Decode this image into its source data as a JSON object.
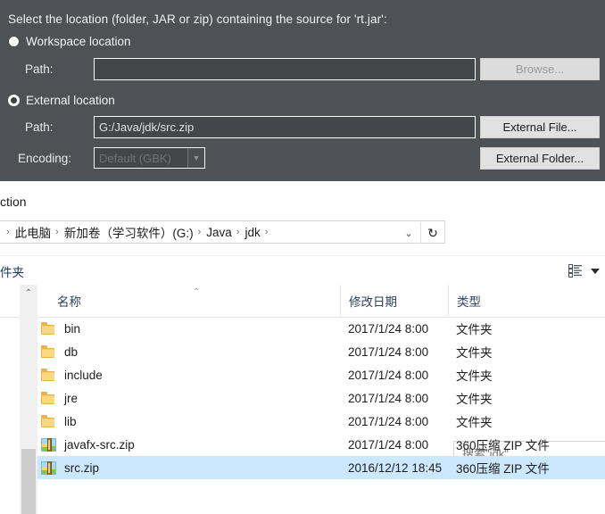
{
  "dialog": {
    "title": "Select the location (folder, JAR or zip) containing the source for 'rt.jar':",
    "workspace_option": {
      "label": "Workspace location",
      "selected": false,
      "path_label": "Path:",
      "path_value": "",
      "browse_button": "Browse...",
      "browse_disabled": true
    },
    "external_option": {
      "label": "External location",
      "selected": true,
      "path_label": "Path:",
      "path_value": "G:/Java/jdk/src.zip",
      "encoding_label": "Encoding:",
      "encoding_value": "Default (GBK)",
      "encoding_disabled": true,
      "external_file_button": "External File...",
      "external_folder_button": "External Folder..."
    },
    "background_color": "#4e5256"
  },
  "explorer": {
    "caption": "ction",
    "address": {
      "crumbs": [
        "此电脑",
        "新加卷（学习软件）(G:)",
        "Java",
        "jdk"
      ],
      "separator": "›",
      "chevron_icon": "chevron-down-icon",
      "refresh_icon": "refresh-icon"
    },
    "search": {
      "placeholder": "搜索\"jdk\"",
      "value": ""
    },
    "toolbar": {
      "new_folder_label": "件夹",
      "view_icon": "list-view-icon",
      "options_icon": "caret-down-icon"
    },
    "columns": [
      "名称",
      "修改日期",
      "类型"
    ],
    "sort_indicator": "^",
    "files": [
      {
        "name": "bin",
        "date": "2017/1/24 8:00",
        "type": "文件夹",
        "icon": "folder-icon",
        "selected": false
      },
      {
        "name": "db",
        "date": "2017/1/24 8:00",
        "type": "文件夹",
        "icon": "folder-icon",
        "selected": false
      },
      {
        "name": "include",
        "date": "2017/1/24 8:00",
        "type": "文件夹",
        "icon": "folder-icon",
        "selected": false
      },
      {
        "name": "jre",
        "date": "2017/1/24 8:00",
        "type": "文件夹",
        "icon": "folder-icon",
        "selected": false
      },
      {
        "name": "lib",
        "date": "2017/1/24 8:00",
        "type": "文件夹",
        "icon": "folder-icon",
        "selected": false
      },
      {
        "name": "javafx-src.zip",
        "date": "2017/1/24 8:00",
        "type": "360压缩 ZIP 文件",
        "icon": "zip-icon",
        "selected": false
      },
      {
        "name": "src.zip",
        "date": "2016/12/12 18:45",
        "type": "360压缩 ZIP 文件",
        "icon": "zip-icon",
        "selected": true
      }
    ],
    "selection_color": "#cce8ff",
    "scrollbar_up_icon": "chevron-up-icon"
  }
}
